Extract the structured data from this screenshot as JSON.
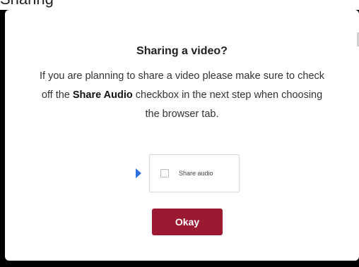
{
  "top_fragment": "Sharing",
  "dialog": {
    "title": "Sharing a video?",
    "message_part1": "If you are planning to share a video please make sure to check off the ",
    "message_bold": "Share Audio",
    "message_part2": " checkbox in the next step when choosing the browser tab.",
    "preview": {
      "checkbox_label": "Share audio",
      "checkbox_checked": false
    },
    "okay_label": "Okay"
  },
  "colors": {
    "accent": "#9b1a32",
    "arrow": "#2d6fe0"
  },
  "icons": {
    "arrow": "play-arrow-icon",
    "checkbox": "checkbox-icon"
  }
}
